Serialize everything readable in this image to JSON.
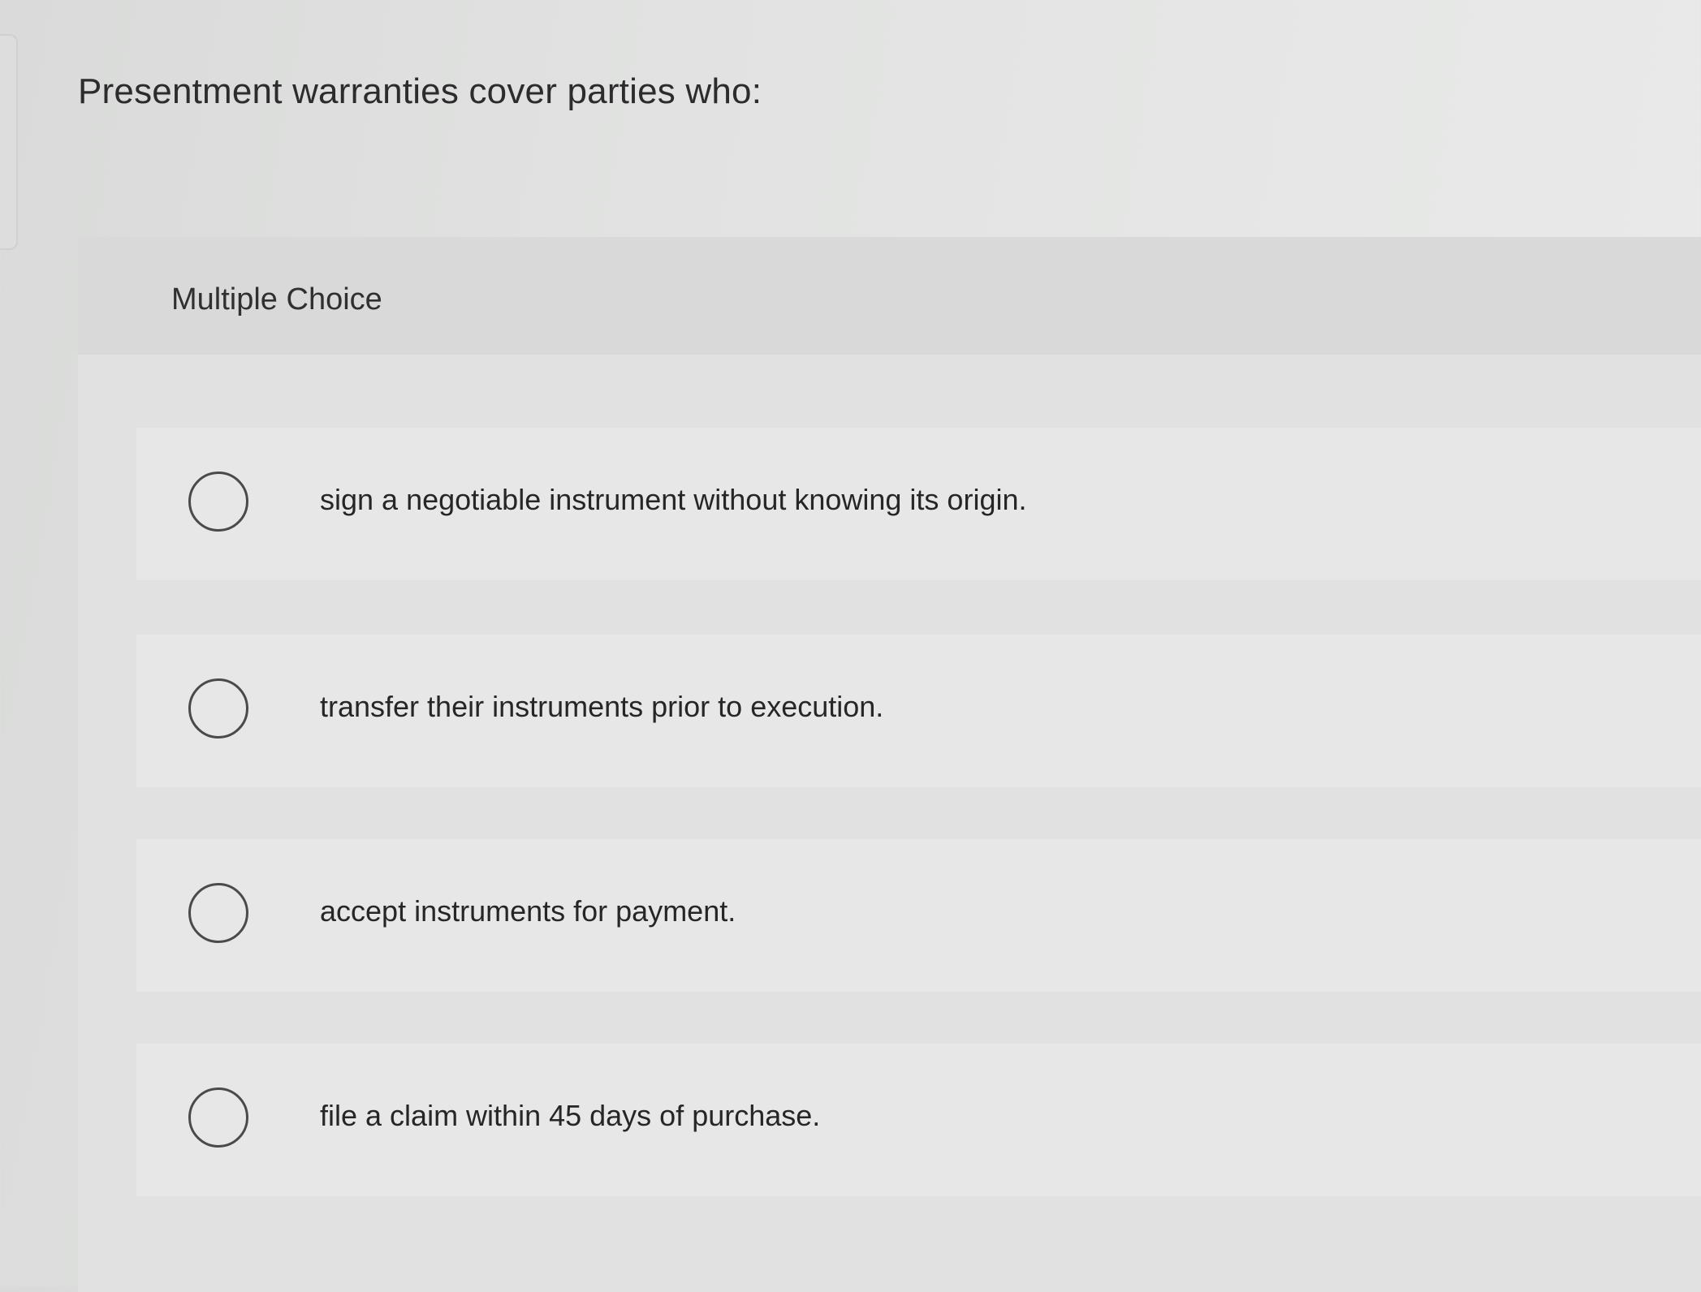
{
  "question": {
    "text": "Presentment warranties cover parties who:"
  },
  "panel": {
    "title": "Multiple Choice"
  },
  "options": [
    {
      "label": "sign a negotiable instrument without knowing its origin.",
      "selected": false
    },
    {
      "label": "transfer their instruments prior to execution.",
      "selected": false
    },
    {
      "label": "accept instruments for payment.",
      "selected": false
    },
    {
      "label": "file a claim within 45 days of purchase.",
      "selected": false
    }
  ]
}
